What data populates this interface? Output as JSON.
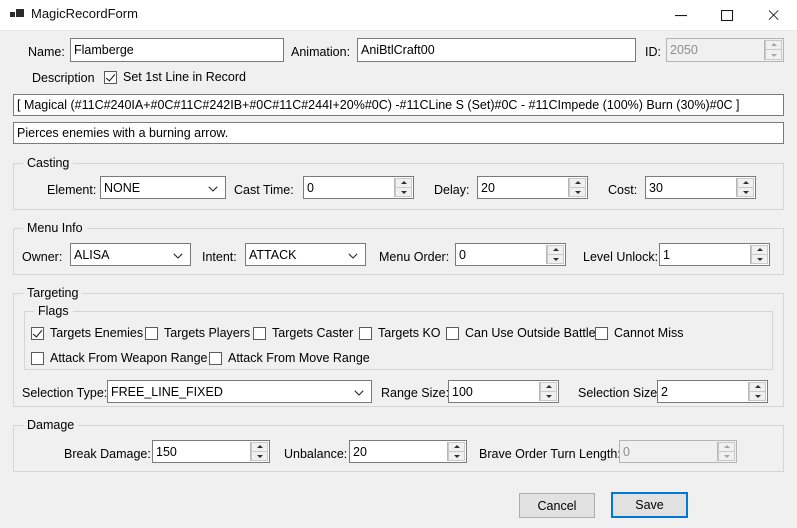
{
  "window": {
    "title": "MagicRecordForm",
    "icon": "app-squares-icon",
    "controls": {
      "minimize": "minimize-icon",
      "maximize": "maximize-icon",
      "close": "close-icon"
    }
  },
  "header": {
    "name_label": "Name:",
    "name_value": "Flamberge",
    "animation_label": "Animation:",
    "animation_value": "AniBtlCraft00",
    "id_label": "ID:",
    "id_value": "2050",
    "id_disabled": true,
    "description_label": "Description",
    "set_first_line_label": "Set 1st Line in Record",
    "set_first_line_checked": true,
    "description_line1": "[ Magical (#11C#240IA+#0C#11C#242IB+#0C#11C#244I+20%#0C) -#11CLine S (Set)#0C - #11CImpede (100%) Burn (30%)#0C ]",
    "description_line2": "Pierces enemies with a burning arrow."
  },
  "casting": {
    "title": "Casting",
    "element_label": "Element:",
    "element_value": "NONE",
    "cast_time_label": "Cast Time:",
    "cast_time_value": "0",
    "delay_label": "Delay:",
    "delay_value": "20",
    "cost_label": "Cost:",
    "cost_value": "30"
  },
  "menu_info": {
    "title": "Menu Info",
    "owner_label": "Owner:",
    "owner_value": "ALISA",
    "intent_label": "Intent:",
    "intent_value": "ATTACK",
    "menu_order_label": "Menu Order:",
    "menu_order_value": "0",
    "level_unlock_label": "Level Unlock:",
    "level_unlock_value": "1"
  },
  "targeting": {
    "title": "Targeting",
    "flags_title": "Flags",
    "flags": [
      {
        "label": "Targets Enemies",
        "checked": true
      },
      {
        "label": "Targets Players",
        "checked": false
      },
      {
        "label": "Targets Caster",
        "checked": false
      },
      {
        "label": "Targets KO",
        "checked": false
      },
      {
        "label": "Can Use Outside Battle",
        "checked": false
      },
      {
        "label": "Cannot Miss",
        "checked": false
      },
      {
        "label": "Attack From Weapon Range",
        "checked": false
      },
      {
        "label": "Attack From Move Range",
        "checked": false
      }
    ],
    "selection_type_label": "Selection Type:",
    "selection_type_value": "FREE_LINE_FIXED",
    "range_size_label": "Range Size:",
    "range_size_value": "100",
    "selection_size_label": "Selection Size:",
    "selection_size_value": "2"
  },
  "damage": {
    "title": "Damage",
    "break_damage_label": "Break Damage:",
    "break_damage_value": "150",
    "unbalance_label": "Unbalance:",
    "unbalance_value": "20",
    "brave_order_label": "Brave Order Turn Length:",
    "brave_order_value": "0",
    "brave_order_disabled": true
  },
  "footer": {
    "cancel_label": "Cancel",
    "save_label": "Save"
  },
  "colors": {
    "window_background": "#f0f0f0",
    "titlebar_background": "#ffffff",
    "field_border": "#7a7a7a",
    "group_border": "#d5d5d5",
    "accent_focus": "#0078d7",
    "disabled_text": "#8d8d8d"
  }
}
